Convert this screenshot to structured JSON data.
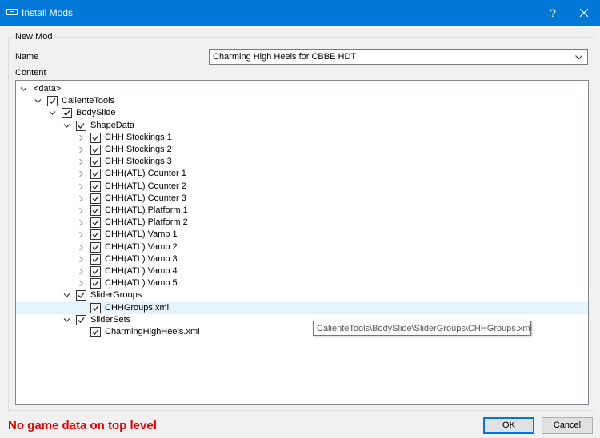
{
  "window": {
    "title": "Install Mods",
    "help_label": "?"
  },
  "group": {
    "title": "New Mod",
    "name_label": "Name",
    "name_value": "Charming High Heels for CBBE HDT",
    "content_label": "Content"
  },
  "tree": [
    {
      "label": "<data>",
      "depth": 0,
      "expander": "expanded",
      "checkbox": false,
      "checked": false,
      "selected": false
    },
    {
      "label": "CalienteTools",
      "depth": 1,
      "expander": "expanded",
      "checkbox": true,
      "checked": true,
      "selected": false
    },
    {
      "label": "BodySlide",
      "depth": 2,
      "expander": "expanded",
      "checkbox": true,
      "checked": true,
      "selected": false
    },
    {
      "label": "ShapeData",
      "depth": 3,
      "expander": "expanded",
      "checkbox": true,
      "checked": true,
      "selected": false
    },
    {
      "label": "CHH Stockings 1",
      "depth": 4,
      "expander": "collapsed",
      "checkbox": true,
      "checked": true,
      "selected": false
    },
    {
      "label": "CHH Stockings 2",
      "depth": 4,
      "expander": "collapsed",
      "checkbox": true,
      "checked": true,
      "selected": false
    },
    {
      "label": "CHH Stockings 3",
      "depth": 4,
      "expander": "collapsed",
      "checkbox": true,
      "checked": true,
      "selected": false
    },
    {
      "label": "CHH(ATL) Counter 1",
      "depth": 4,
      "expander": "collapsed",
      "checkbox": true,
      "checked": true,
      "selected": false
    },
    {
      "label": "CHH(ATL) Counter 2",
      "depth": 4,
      "expander": "collapsed",
      "checkbox": true,
      "checked": true,
      "selected": false
    },
    {
      "label": "CHH(ATL) Counter 3",
      "depth": 4,
      "expander": "collapsed",
      "checkbox": true,
      "checked": true,
      "selected": false
    },
    {
      "label": "CHH(ATL) Platform 1",
      "depth": 4,
      "expander": "collapsed",
      "checkbox": true,
      "checked": true,
      "selected": false
    },
    {
      "label": "CHH(ATL) Platform 2",
      "depth": 4,
      "expander": "collapsed",
      "checkbox": true,
      "checked": true,
      "selected": false
    },
    {
      "label": "CHH(ATL) Vamp 1",
      "depth": 4,
      "expander": "collapsed",
      "checkbox": true,
      "checked": true,
      "selected": false
    },
    {
      "label": "CHH(ATL) Vamp 2",
      "depth": 4,
      "expander": "collapsed",
      "checkbox": true,
      "checked": true,
      "selected": false
    },
    {
      "label": "CHH(ATL) Vamp 3",
      "depth": 4,
      "expander": "collapsed",
      "checkbox": true,
      "checked": true,
      "selected": false
    },
    {
      "label": "CHH(ATL) Vamp 4",
      "depth": 4,
      "expander": "collapsed",
      "checkbox": true,
      "checked": true,
      "selected": false
    },
    {
      "label": "CHH(ATL) Vamp 5",
      "depth": 4,
      "expander": "collapsed",
      "checkbox": true,
      "checked": true,
      "selected": false
    },
    {
      "label": "SliderGroups",
      "depth": 3,
      "expander": "expanded",
      "checkbox": true,
      "checked": true,
      "selected": false
    },
    {
      "label": "CHHGroups.xml",
      "depth": 4,
      "expander": "none",
      "checkbox": true,
      "checked": true,
      "selected": true
    },
    {
      "label": "SliderSets",
      "depth": 3,
      "expander": "expanded",
      "checkbox": true,
      "checked": true,
      "selected": false
    },
    {
      "label": "CharmingHighHeels.xml",
      "depth": 4,
      "expander": "none",
      "checkbox": true,
      "checked": true,
      "selected": false
    }
  ],
  "tooltip": "CalienteTools\\BodySlide\\SliderGroups\\CHHGroups.xml",
  "footer": {
    "error": "No game data on top level",
    "error_color": "#e50000",
    "ok_label": "OK",
    "cancel_label": "Cancel"
  },
  "colors": {
    "titlebar": "#0078d7",
    "selected_row": "#e5f3fb"
  }
}
